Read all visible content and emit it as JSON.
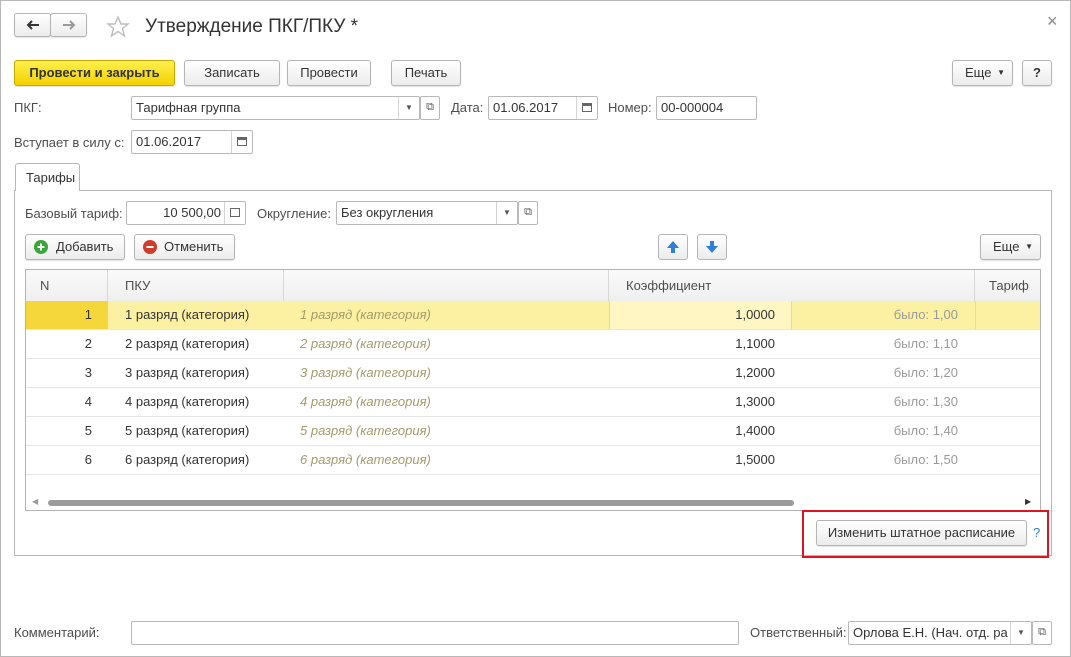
{
  "window": {
    "title": "Утверждение ПКГ/ПКУ *",
    "close_glyph": "×"
  },
  "toolbar": {
    "post_close_label": "Провести и закрыть",
    "save_label": "Записать",
    "post_label": "Провести",
    "print_label": "Печать",
    "more_label": "Еще",
    "help_label": "?"
  },
  "header": {
    "pkg_label": "ПКГ:",
    "pkg_value": "Тарифная группа",
    "date_label": "Дата:",
    "date_value": "01.06.2017",
    "number_label": "Номер:",
    "number_value": "00-000004",
    "effective_label": "Вступает в силу с:",
    "effective_value": "01.06.2017"
  },
  "tabs": [
    {
      "label": "Тарифы"
    }
  ],
  "tariffs": {
    "base_label": "Базовый тариф:",
    "base_value": "10 500,00",
    "rounding_label": "Округление:",
    "rounding_value": "Без округления",
    "add_label": "Добавить",
    "cancel_label": "Отменить",
    "more_label": "Еще",
    "columns": {
      "n": "N",
      "pku": "ПКУ",
      "coef": "Коэффициент",
      "tariff": "Тариф"
    },
    "rows": [
      {
        "n": "1",
        "pku": "1 разряд (категория)",
        "pku_hint": "1 разряд (категория)",
        "coef": "1,0000",
        "was": "было: 1,00"
      },
      {
        "n": "2",
        "pku": "2 разряд (категория)",
        "pku_hint": "2 разряд (категория)",
        "coef": "1,1000",
        "was": "было: 1,10"
      },
      {
        "n": "3",
        "pku": "3 разряд (категория)",
        "pku_hint": "3 разряд (категория)",
        "coef": "1,2000",
        "was": "было: 1,20"
      },
      {
        "n": "4",
        "pku": "4 разряд (категория)",
        "pku_hint": "4 разряд (категория)",
        "coef": "1,3000",
        "was": "было: 1,30"
      },
      {
        "n": "5",
        "pku": "5 разряд (категория)",
        "pku_hint": "5 разряд (категория)",
        "coef": "1,4000",
        "was": "было: 1,40"
      },
      {
        "n": "6",
        "pku": "6 разряд (категория)",
        "pku_hint": "6 разряд (категория)",
        "coef": "1,5000",
        "was": "было: 1,50"
      }
    ],
    "change_schedule_label": "Изменить штатное расписание",
    "help_label": "?"
  },
  "footer": {
    "comment_label": "Комментарий:",
    "comment_value": "",
    "responsible_label": "Ответственный:",
    "responsible_value": "Орлова Е.Н. (Нач. отд. ра"
  },
  "colors": {
    "primary_button": "#f3d100",
    "selected_row": "#fcf1a3",
    "highlight_frame": "#e0141e",
    "add_icon": "#3aa53a",
    "cancel_icon": "#d23a2a",
    "arrow_icon": "#2f7fd6"
  }
}
